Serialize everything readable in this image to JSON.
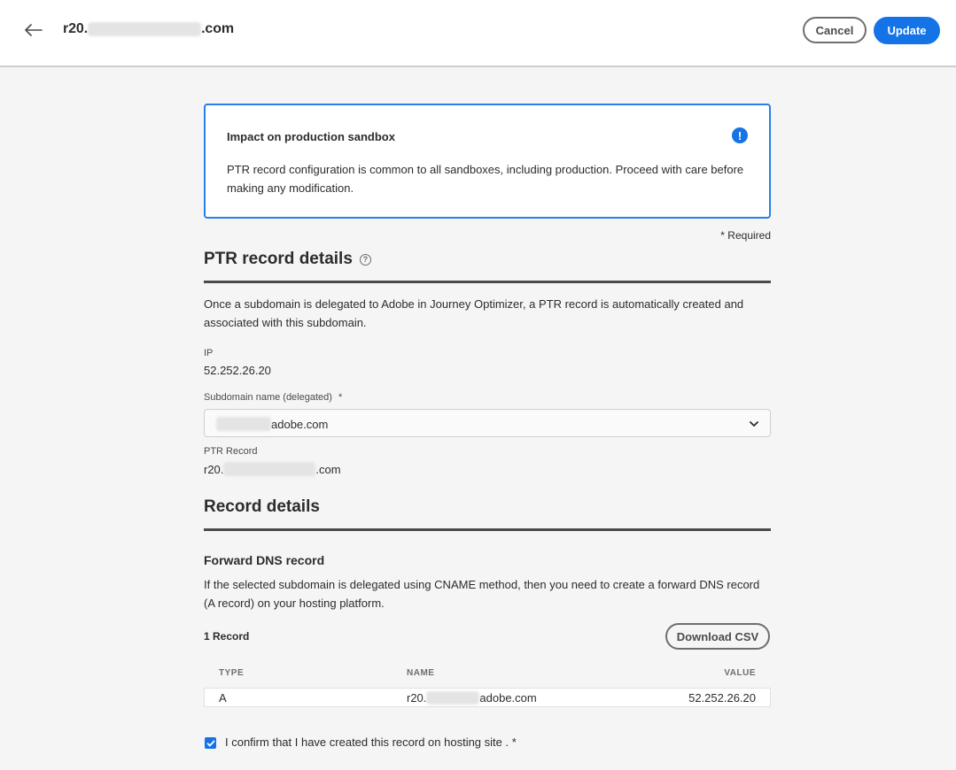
{
  "header": {
    "title_prefix": "r20.",
    "title_suffix": ".com",
    "cancel_label": "Cancel",
    "update_label": "Update"
  },
  "alert": {
    "title": "Impact on production sandbox",
    "body": "PTR record configuration is common to all sandboxes, including production. Proceed with care before making any modification.",
    "icon": "!"
  },
  "required_note": "* Required",
  "ptr_section": {
    "title": "PTR record details",
    "help_icon": "?",
    "description": "Once a subdomain is delegated to Adobe in Journey Optimizer, a PTR record is automatically created and associated with this subdomain.",
    "ip_label": "IP",
    "ip_value": "52.252.26.20",
    "subdomain_label": "Subdomain name (delegated)",
    "subdomain_required_mark": "*",
    "subdomain_value_suffix": "adobe.com",
    "ptr_record_label": "PTR Record",
    "ptr_record_prefix": "r20.",
    "ptr_record_suffix": ".com"
  },
  "record_section": {
    "title": "Record details",
    "forward_dns_title": "Forward DNS record",
    "forward_dns_description": "If the selected subdomain is delegated using CNAME method, then you need to create a forward DNS record (A record) on your hosting platform.",
    "record_count": "1 Record",
    "download_csv_label": "Download CSV",
    "columns": [
      "TYPE",
      "NAME",
      "VALUE"
    ],
    "rows": [
      {
        "type": "A",
        "name_prefix": "r20.",
        "name_suffix": "adobe.com",
        "value": "52.252.26.20"
      }
    ],
    "confirm_label": "I confirm that I have created this record on hosting site . *",
    "confirm_checked": true
  },
  "colors": {
    "accent": "#1473e6",
    "alert_border": "#2680eb",
    "background": "#f5f5f5"
  }
}
